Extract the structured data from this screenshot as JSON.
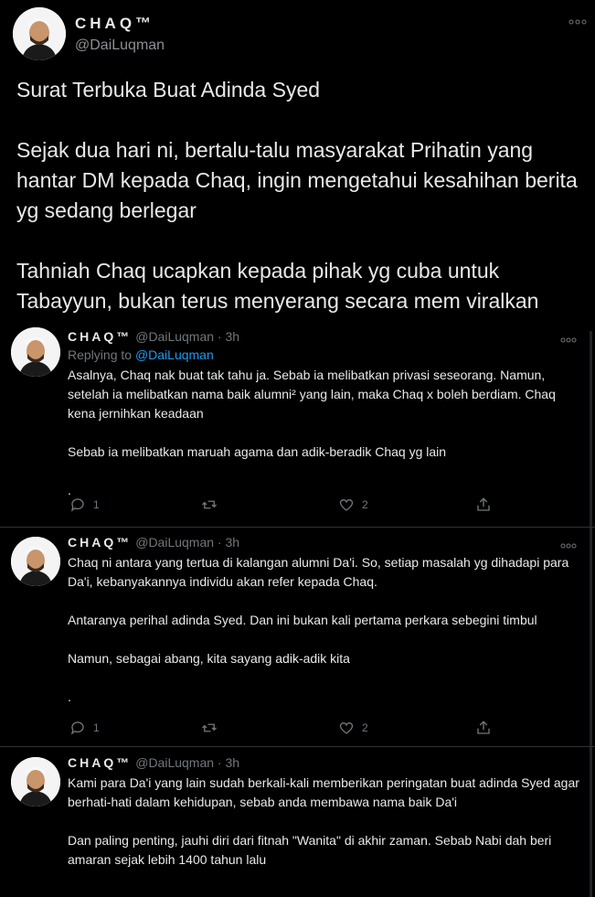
{
  "main_tweet": {
    "author_name": "CHAQ™",
    "handle": "@DaiLuqman",
    "paragraphs": [
      "Surat Terbuka Buat Adinda Syed",
      "Sejak dua hari ni, bertalu-talu masyarakat Prihatin yang hantar DM kepada Chaq, ingin mengetahui kesahihan berita yg sedang berlegar",
      "Tahniah Chaq ucapkan kepada pihak yg cuba untuk Tabayyun, bukan terus menyerang secara mem viralkan"
    ]
  },
  "replies": [
    {
      "author_name": "CHAQ™",
      "meta": "@DaiLuqman · 3h",
      "replying_prefix": "Replying to ",
      "replying_to": "@DaiLuqman",
      "paragraphs": [
        "Asalnya, Chaq nak buat tak tahu ja. Sebab ia melibatkan privasi seseorang. Namun, setelah ia melibatkan nama baik alumni² yang lain, maka Chaq x boleh berdiam. Chaq kena jernihkan keadaan",
        "Sebab ia melibatkan maruah agama dan adik-beradik Chaq yg lain",
        "."
      ],
      "reply_count": "1",
      "like_count": "2"
    },
    {
      "author_name": "CHAQ™",
      "meta": "@DaiLuqman · 3h",
      "paragraphs": [
        "Chaq ni antara yang tertua di kalangan alumni Da'i. So, setiap masalah yg dihadapi para Da'i, kebanyakannya individu akan refer kepada Chaq.",
        "Antaranya perihal adinda Syed. Dan ini bukan kali pertama perkara sebegini timbul",
        "Namun, sebagai abang, kita sayang adik-adik kita",
        "."
      ],
      "reply_count": "1",
      "like_count": "2"
    },
    {
      "author_name": "CHAQ™",
      "meta": "@DaiLuqman · 3h",
      "paragraphs": [
        "Kami para Da'i yang lain sudah berkali-kali memberikan peringatan buat adinda Syed agar berhati-hati dalam kehidupan, sebab anda membawa nama baik Da'i",
        "Dan paling penting, jauhi diri dari fitnah \"Wanita\" di akhir zaman. Sebab Nabi dah beri amaran sejak lebih 1400 tahun lalu"
      ]
    }
  ],
  "icons": {
    "more": "more-dots-icon",
    "reply": "reply-bubble-icon",
    "retweet": "retweet-icon",
    "like": "heart-icon",
    "share": "share-icon"
  },
  "colors": {
    "background": "#000000",
    "text": "#e7e9ea",
    "muted": "#71767b",
    "link": "#1d9bf0"
  }
}
